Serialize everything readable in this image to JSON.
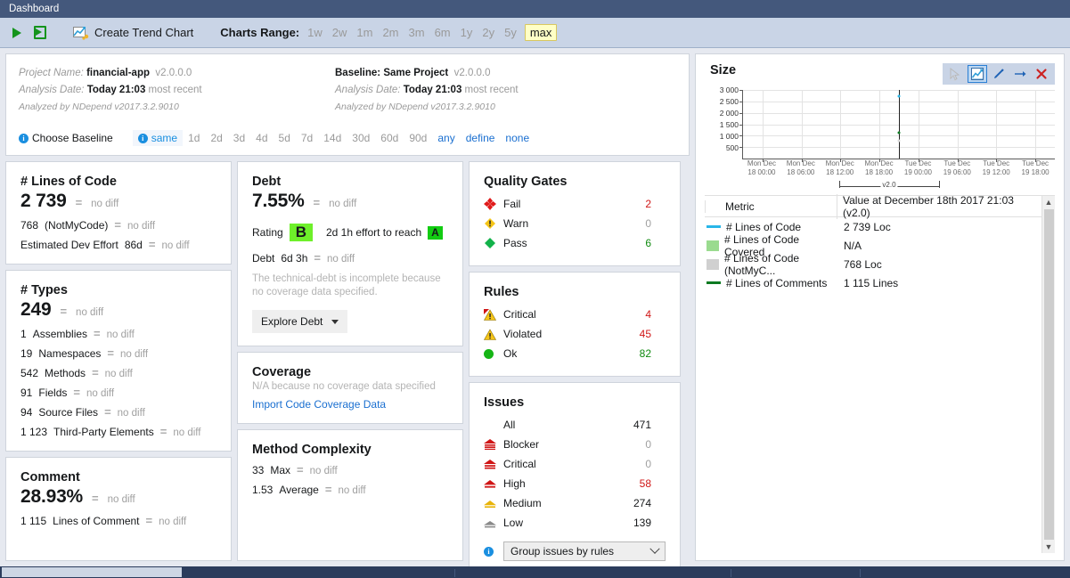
{
  "window": {
    "tab_label": "Dashboard"
  },
  "toolbar": {
    "run_icon": "play-icon",
    "export_icon": "export-icon",
    "create_trend_chart": "Create Trend Chart",
    "charts_range_label": "Charts Range:",
    "ranges": [
      "1w",
      "2w",
      "1m",
      "2m",
      "3m",
      "6m",
      "1y",
      "2y",
      "5y",
      "max"
    ],
    "active_range": "max"
  },
  "project": {
    "name_label": "Project Name:",
    "name_value": "financial-app",
    "name_version": "v2.0.0.0",
    "analysis_label": "Analysis Date:",
    "analysis_value": "Today 21:03",
    "analysis_suffix": "most recent",
    "analyzed_by": "Analyzed by NDepend v2017.3.2.9010",
    "baseline_label": "Baseline:",
    "baseline_value": "Same Project",
    "baseline_version": "v2.0.0.0",
    "b_analysis_label": "Analysis Date:",
    "b_analysis_value": "Today 21:03",
    "b_analysis_suffix": "most recent",
    "b_analyzed_by": "Analyzed by NDepend v2017.3.2.9010",
    "choose_baseline": "Choose Baseline",
    "options": [
      "same",
      "1d",
      "2d",
      "3d",
      "4d",
      "5d",
      "7d",
      "14d",
      "30d",
      "60d",
      "90d",
      "any",
      "define",
      "none"
    ],
    "selected_option": "same"
  },
  "lines_of_code": {
    "title": "# Lines of Code",
    "value": "2 739",
    "diff": "no diff",
    "rows": [
      {
        "num": "768",
        "label": "(NotMyCode)",
        "diff": "no diff"
      },
      {
        "num": "Estimated Dev Effort",
        "label": "86d",
        "diff": "no diff"
      }
    ]
  },
  "types": {
    "title": "# Types",
    "value": "249",
    "diff": "no diff",
    "rows": [
      {
        "num": "1",
        "label": "Assemblies",
        "diff": "no diff"
      },
      {
        "num": "19",
        "label": "Namespaces",
        "diff": "no diff"
      },
      {
        "num": "542",
        "label": "Methods",
        "diff": "no diff"
      },
      {
        "num": "91",
        "label": "Fields",
        "diff": "no diff"
      },
      {
        "num": "94",
        "label": "Source Files",
        "diff": "no diff"
      },
      {
        "num": "1 123",
        "label": "Third-Party Elements",
        "diff": "no diff"
      }
    ]
  },
  "comment": {
    "title": "Comment",
    "value": "28.93%",
    "diff": "no diff",
    "rows": [
      {
        "num": "1 115",
        "label": "Lines of Comment",
        "diff": "no diff"
      }
    ]
  },
  "debt": {
    "title": "Debt",
    "value": "7.55%",
    "diff": "no diff",
    "rating_label": "Rating",
    "rating_value": "B",
    "effort_text": "2d  1h effort to reach",
    "target_rating": "A",
    "debt_label": "Debt",
    "debt_value": "6d  3h",
    "debt_diff": "no diff",
    "note": "The technical-debt is incomplete because no coverage data specified.",
    "explore_button": "Explore Debt"
  },
  "coverage": {
    "title": "Coverage",
    "subtitle": "N/A because no coverage data specified",
    "link": "Import Code Coverage Data"
  },
  "method_complexity": {
    "title": "Method Complexity",
    "rows": [
      {
        "num": "33",
        "label": "Max",
        "diff": "no diff"
      },
      {
        "num": "1.53",
        "label": "Average",
        "diff": "no diff"
      }
    ]
  },
  "quality_gates": {
    "title": "Quality Gates",
    "rows": [
      {
        "icon": "fail-diamond-icon",
        "label": "Fail",
        "value": "2",
        "tone": "red"
      },
      {
        "icon": "warn-diamond-icon",
        "label": "Warn",
        "value": "0",
        "tone": "grey"
      },
      {
        "icon": "pass-diamond-icon",
        "label": "Pass",
        "value": "6",
        "tone": "green"
      }
    ]
  },
  "rules": {
    "title": "Rules",
    "rows": [
      {
        "icon": "critical-warning-icon",
        "label": "Critical",
        "value": "4",
        "tone": "red"
      },
      {
        "icon": "warning-icon",
        "label": "Violated",
        "value": "45",
        "tone": "red"
      },
      {
        "icon": "ok-circle-icon",
        "label": "Ok",
        "value": "82",
        "tone": "green"
      }
    ]
  },
  "issues": {
    "title": "Issues",
    "rows": [
      {
        "icon": "",
        "label": "All",
        "value": "471",
        "tone": "dark"
      },
      {
        "icon": "severity-blocker-icon",
        "label": "Blocker",
        "value": "0",
        "tone": "grey"
      },
      {
        "icon": "severity-critical-icon",
        "label": "Critical",
        "value": "0",
        "tone": "grey"
      },
      {
        "icon": "severity-high-icon",
        "label": "High",
        "value": "58",
        "tone": "red"
      },
      {
        "icon": "severity-medium-icon",
        "label": "Medium",
        "value": "274",
        "tone": "dark"
      },
      {
        "icon": "severity-low-icon",
        "label": "Low",
        "value": "139",
        "tone": "dark"
      }
    ],
    "group_select_value": "Group issues by rules"
  },
  "size_chart": {
    "title": "Size",
    "tools": [
      "pointer-icon",
      "chart-icon",
      "edit-icon",
      "arrow-right-icon",
      "close-icon"
    ],
    "selected_tool": "chart-icon",
    "legend_headers": [
      "Metric",
      "Value at December 18th 2017  21:03  (v2.0)"
    ],
    "legend_rows": [
      {
        "swatch": "line",
        "color": "#29b6e8",
        "metric": "# Lines of Code",
        "value": "2 739 Loc"
      },
      {
        "swatch": "box",
        "color": "#9adb8f",
        "metric": "# Lines of Code Covered",
        "value": "N/A"
      },
      {
        "swatch": "box",
        "color": "#d0d0d0",
        "metric": "# Lines of Code (NotMyC...",
        "value": "768 Loc"
      },
      {
        "swatch": "line",
        "color": "#0d7a22",
        "metric": "# Lines of Comments",
        "value": "1 115 Lines"
      }
    ],
    "version_marker": "v2.0"
  },
  "chart_data": {
    "type": "scatter",
    "title": "Size",
    "xlabel": "",
    "ylabel": "",
    "ylim": [
      0,
      3000
    ],
    "yticks": [
      500,
      1000,
      1500,
      2000,
      2500,
      3000
    ],
    "ytick_labels": [
      "500",
      "1 000",
      "1 500",
      "2 000",
      "2 500",
      "3 000"
    ],
    "x_tick_labels": [
      "Mon Dec\n18 00:00",
      "Mon Dec\n18 06:00",
      "Mon Dec\n18 12:00",
      "Mon Dec\n18 18:00",
      "Tue Dec\n19 00:00",
      "Tue Dec\n19 06:00",
      "Tue Dec\n19 12:00",
      "Tue Dec\n19 18:00"
    ],
    "grid": true,
    "legend_position": "bottom-table",
    "series": [
      {
        "name": "# Lines of Code",
        "color": "#29b6e8",
        "x": [
          "Mon Dec 18 21:03"
        ],
        "values": [
          2739
        ]
      },
      {
        "name": "# Lines of Code Covered",
        "color": "#9adb8f",
        "x": [
          "Mon Dec 18 21:03"
        ],
        "values": [
          null
        ]
      },
      {
        "name": "# Lines of Code (NotMyCode)",
        "color": "#d0d0d0",
        "x": [
          "Mon Dec 18 21:03"
        ],
        "values": [
          768
        ]
      },
      {
        "name": "# Lines of Comments",
        "color": "#0d7a22",
        "x": [
          "Mon Dec 18 21:03"
        ],
        "values": [
          1115
        ]
      }
    ],
    "annotations": [
      {
        "text": "v2.0",
        "type": "version-span"
      }
    ]
  }
}
